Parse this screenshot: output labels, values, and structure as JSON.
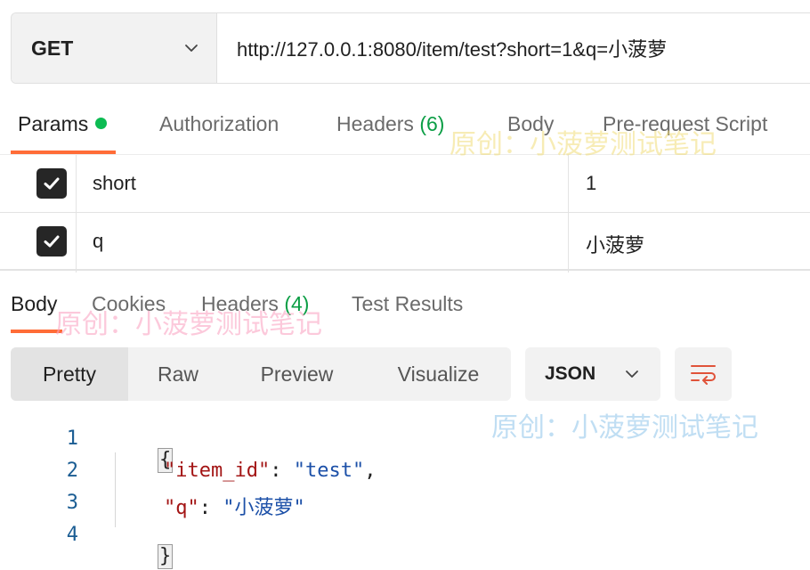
{
  "request": {
    "method": "GET",
    "url": "http://127.0.0.1:8080/item/test?short=1&q=小菠萝"
  },
  "request_tabs": {
    "params": "Params",
    "authorization": "Authorization",
    "headers": "Headers",
    "headers_count": "(6)",
    "body": "Body",
    "pre_request": "Pre-request Script"
  },
  "params": [
    {
      "key": "short",
      "value": "1",
      "checked": true
    },
    {
      "key": "q",
      "value": "小菠萝",
      "checked": true
    }
  ],
  "response_tabs": {
    "body": "Body",
    "cookies": "Cookies",
    "headers": "Headers",
    "headers_count": "(4)",
    "test_results": "Test Results"
  },
  "view_modes": {
    "pretty": "Pretty",
    "raw": "Raw",
    "preview": "Preview",
    "visualize": "Visualize"
  },
  "format": "JSON",
  "response_body": {
    "line_numbers": [
      "1",
      "2",
      "3",
      "4"
    ],
    "open_brace": "{",
    "close_brace": "}",
    "lines": [
      {
        "key": "\"item_id\"",
        "sep": ": ",
        "value": "\"test\"",
        "trail": ","
      },
      {
        "key": "\"q\"",
        "sep": ": ",
        "value": "\"小菠萝\"",
        "trail": ""
      }
    ]
  },
  "watermark": {
    "text": "原创：小菠萝测试笔记"
  },
  "colors": {
    "accent_orange": "#ff6c37",
    "status_green": "#0cbb52",
    "json_key": "#a31515",
    "json_string": "#1c50a8"
  }
}
